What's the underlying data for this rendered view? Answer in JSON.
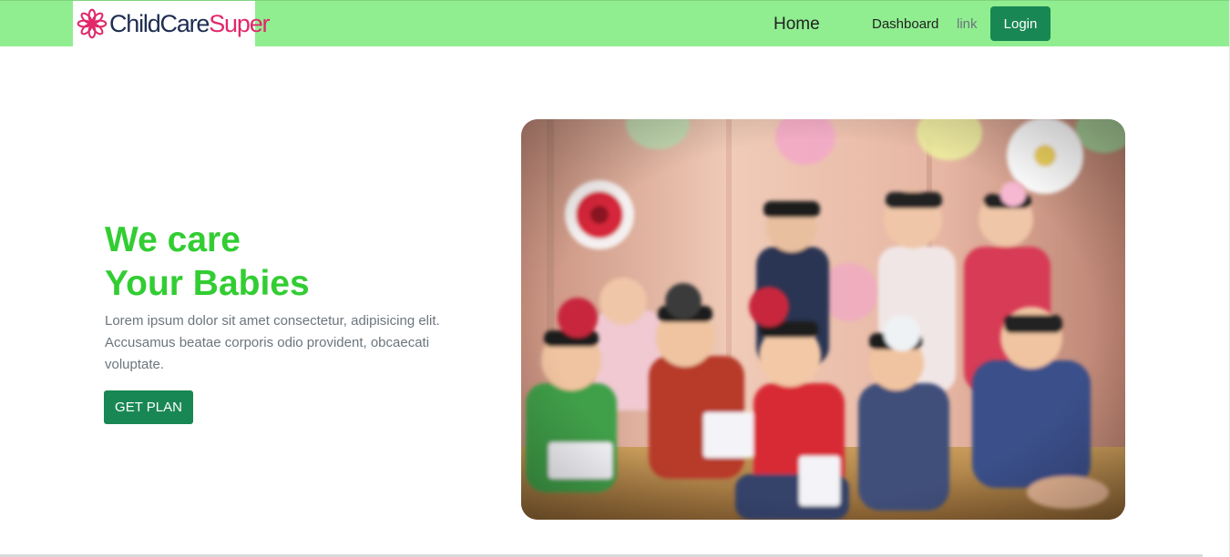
{
  "navbar": {
    "brand_part1": "ChildCare",
    "brand_part2": "Super",
    "brand_icon": "flower-logo-icon",
    "background_color": "#90ee90",
    "items": [
      {
        "label": "Home"
      },
      {
        "label": "Dashboard"
      },
      {
        "label": "link"
      }
    ],
    "login_label": "Login"
  },
  "hero": {
    "title_line1": "We care",
    "title_line2": "Your Babies",
    "title_color": "#32cd32",
    "description": "Lorem ipsum dolor sit amet consectetur, adipisicing elit. Accusamus beatae corporis odio provident, obcaecati voluptate.",
    "button_label": "GET PLAN",
    "button_color": "#198754"
  }
}
